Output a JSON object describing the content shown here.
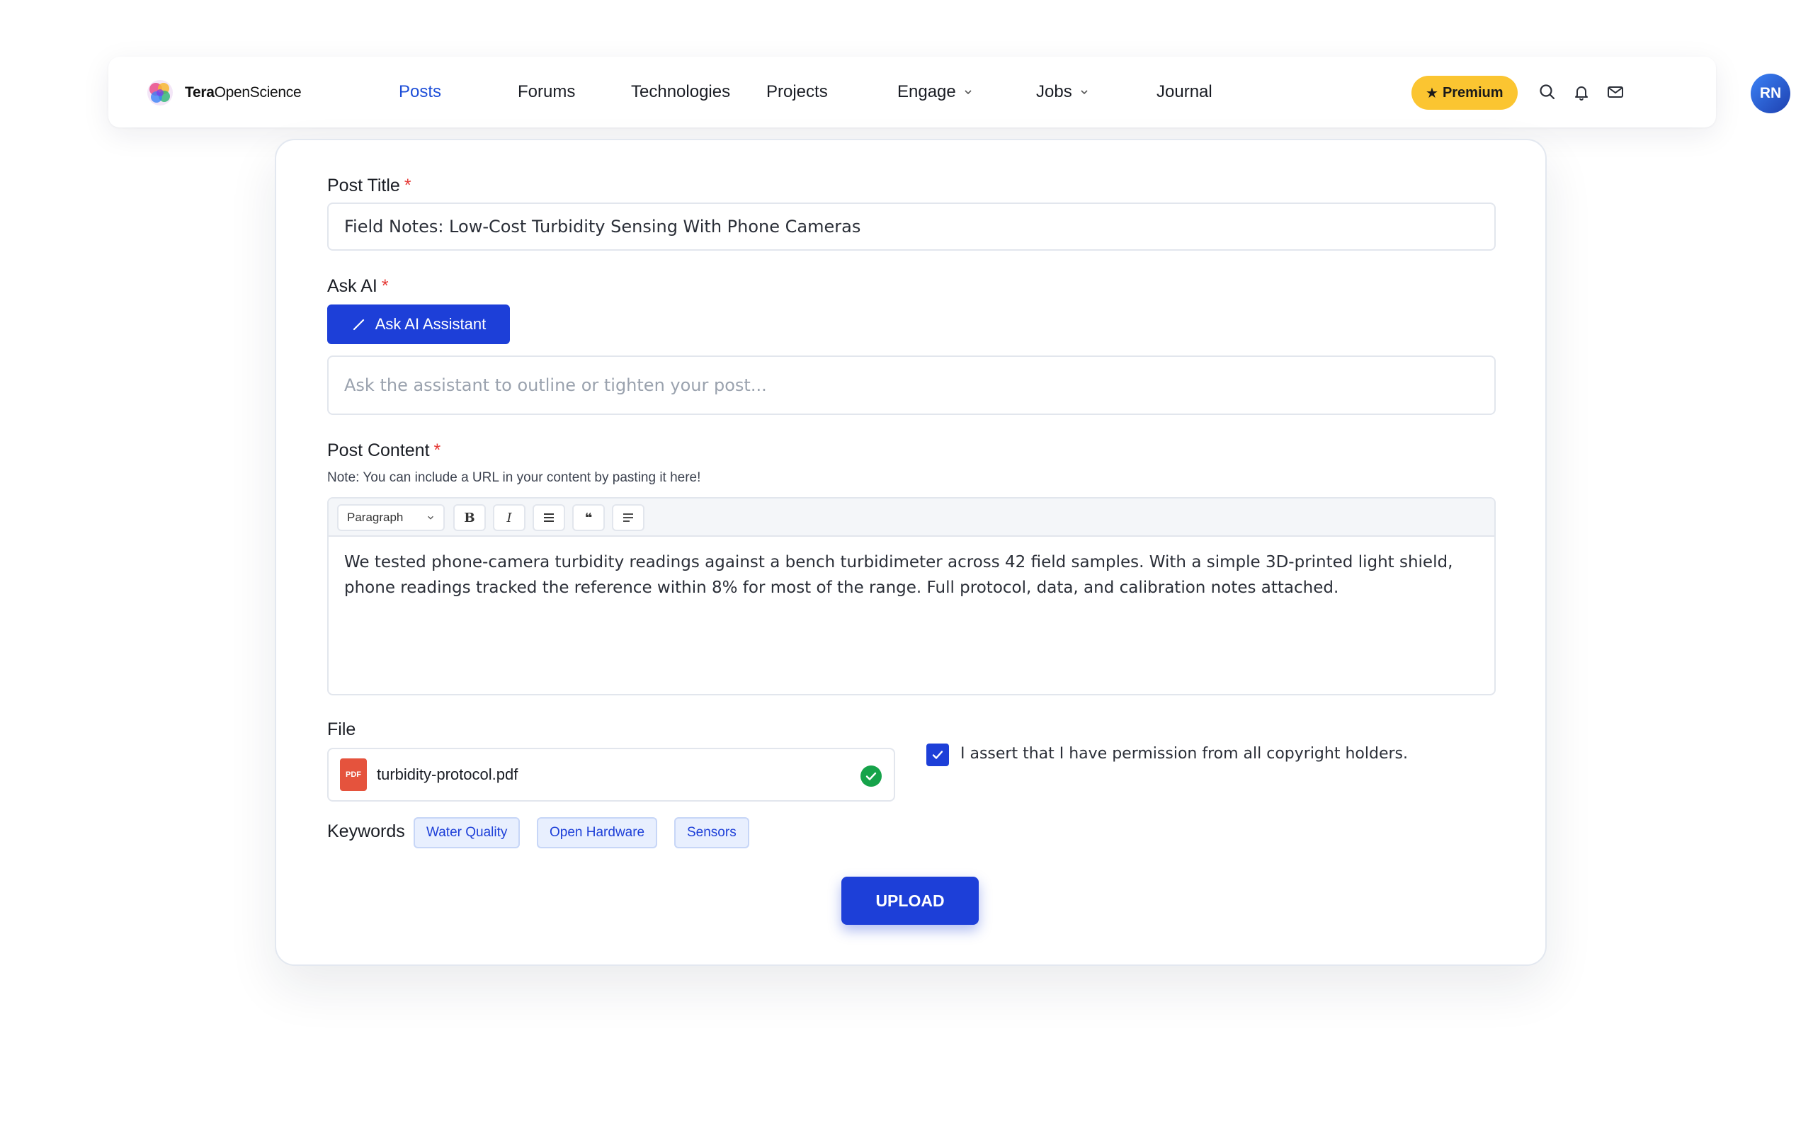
{
  "brand": {
    "name_bold": "Tera",
    "name_rest": "OpenScience"
  },
  "nav": {
    "items": [
      {
        "label": "Posts",
        "active": true
      },
      {
        "label": "Forums"
      },
      {
        "label": "Technologies"
      },
      {
        "label": "Projects"
      },
      {
        "label": "Engage",
        "dropdown": true
      },
      {
        "label": "Jobs",
        "dropdown": true
      },
      {
        "label": "Journal"
      }
    ],
    "premium_label": "Premium",
    "premium_star": "★",
    "icons": [
      "search-icon",
      "bell-icon",
      "mail-icon"
    ],
    "avatar_initials": "RN"
  },
  "form": {
    "post_title_label": "Post Title",
    "required_mark": "*",
    "post_title_value": "Field Notes: Low-Cost Turbidity Sensing With Phone Cameras",
    "ask_ai_label": "Ask AI",
    "ask_ai_button": "Ask AI Assistant",
    "ask_ai_placeholder": "Ask the assistant to outline or tighten your post...",
    "post_content_label": "Post Content",
    "post_content_note": "Note: You can include a URL in your content by pasting it here!",
    "toolbar": {
      "block_select": "Paragraph",
      "bold": "B",
      "italic": "I",
      "quote": "❝"
    },
    "content": "We tested phone-camera turbidity readings against a bench turbidimeter across 42 field samples. With a simple 3D-printed light shield, phone readings tracked the reference within 8% for most of the range. Full protocol, data, and calibration notes attached.",
    "file_label": "File",
    "file_badge": "PDF",
    "file_name": "turbidity-protocol.pdf",
    "copyright_checked": true,
    "copyright_text": "I assert that I have permission from all copyright holders.",
    "keywords_label": "Keywords",
    "keywords": [
      "Water Quality",
      "Open Hardware",
      "Sensors"
    ],
    "upload_button": "UPLOAD"
  },
  "colors": {
    "accent": "#1d3fd8",
    "premium": "#fbc531",
    "required": "#e53935",
    "success": "#16a34a",
    "pdf": "#e5533d"
  }
}
